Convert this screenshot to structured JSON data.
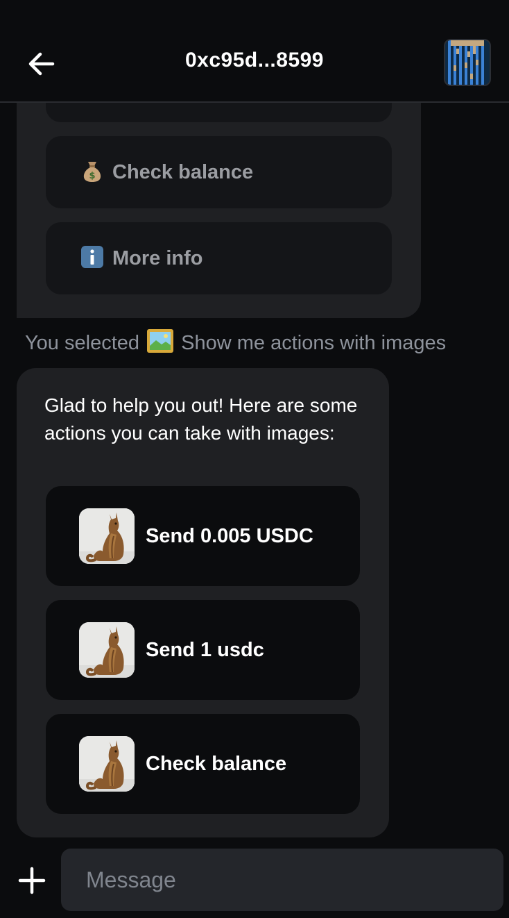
{
  "header": {
    "title": "0xc95d...8599",
    "back_icon": "arrow-left-icon",
    "avatar": "blockie-avatar"
  },
  "top_bubble": {
    "buttons": [
      {
        "label": "",
        "icon": ""
      },
      {
        "label": "Check balance",
        "icon": "money-bag-emoji"
      },
      {
        "label": "More info",
        "icon": "information-emoji"
      }
    ]
  },
  "selected": {
    "prefix": "You selected",
    "icon": "framed-picture-emoji",
    "text": "Show me actions with images"
  },
  "main_bubble": {
    "text": "Glad to help you out! Here are some actions you can take with images:",
    "actions": [
      {
        "label": "Send 0.005 USDC",
        "thumb": "cat-photo"
      },
      {
        "label": "Send 1 usdc",
        "thumb": "cat-photo"
      },
      {
        "label": "Check balance",
        "thumb": "cat-photo"
      }
    ]
  },
  "composer": {
    "placeholder": "Message",
    "plus_icon": "plus-icon"
  },
  "colors": {
    "background": "#0b0c0e",
    "bubble": "#1f2023",
    "button": "#141518",
    "muted_text": "#8e939c",
    "input": "#24262b"
  }
}
